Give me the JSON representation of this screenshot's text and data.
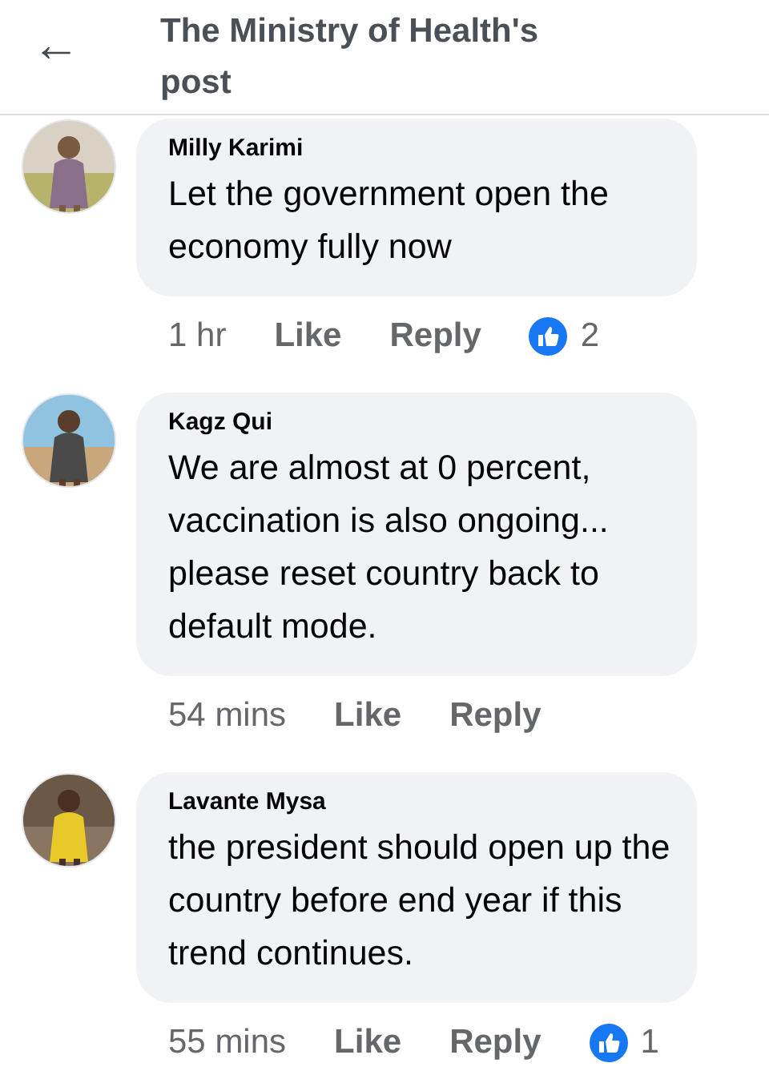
{
  "header": {
    "back": "←",
    "title": "The Ministry of Health's post"
  },
  "comments": [
    {
      "author": "Milly Karimi",
      "text": "Let the government open the economy fully now",
      "time": "1 hr",
      "like": "Like",
      "reply": "Reply",
      "reaction_count": "2"
    },
    {
      "author": "Kagz Qui",
      "text": "We are almost at 0 percent, vaccination is also ongoing... please reset country back to default mode.",
      "time": "54 mins",
      "like": "Like",
      "reply": "Reply"
    },
    {
      "author": "Lavante Mysa",
      "text": "the president should open up the country before end year if this trend continues.",
      "time": "55 mins",
      "like": "Like",
      "reply": "Reply",
      "reaction_count": "1"
    }
  ]
}
